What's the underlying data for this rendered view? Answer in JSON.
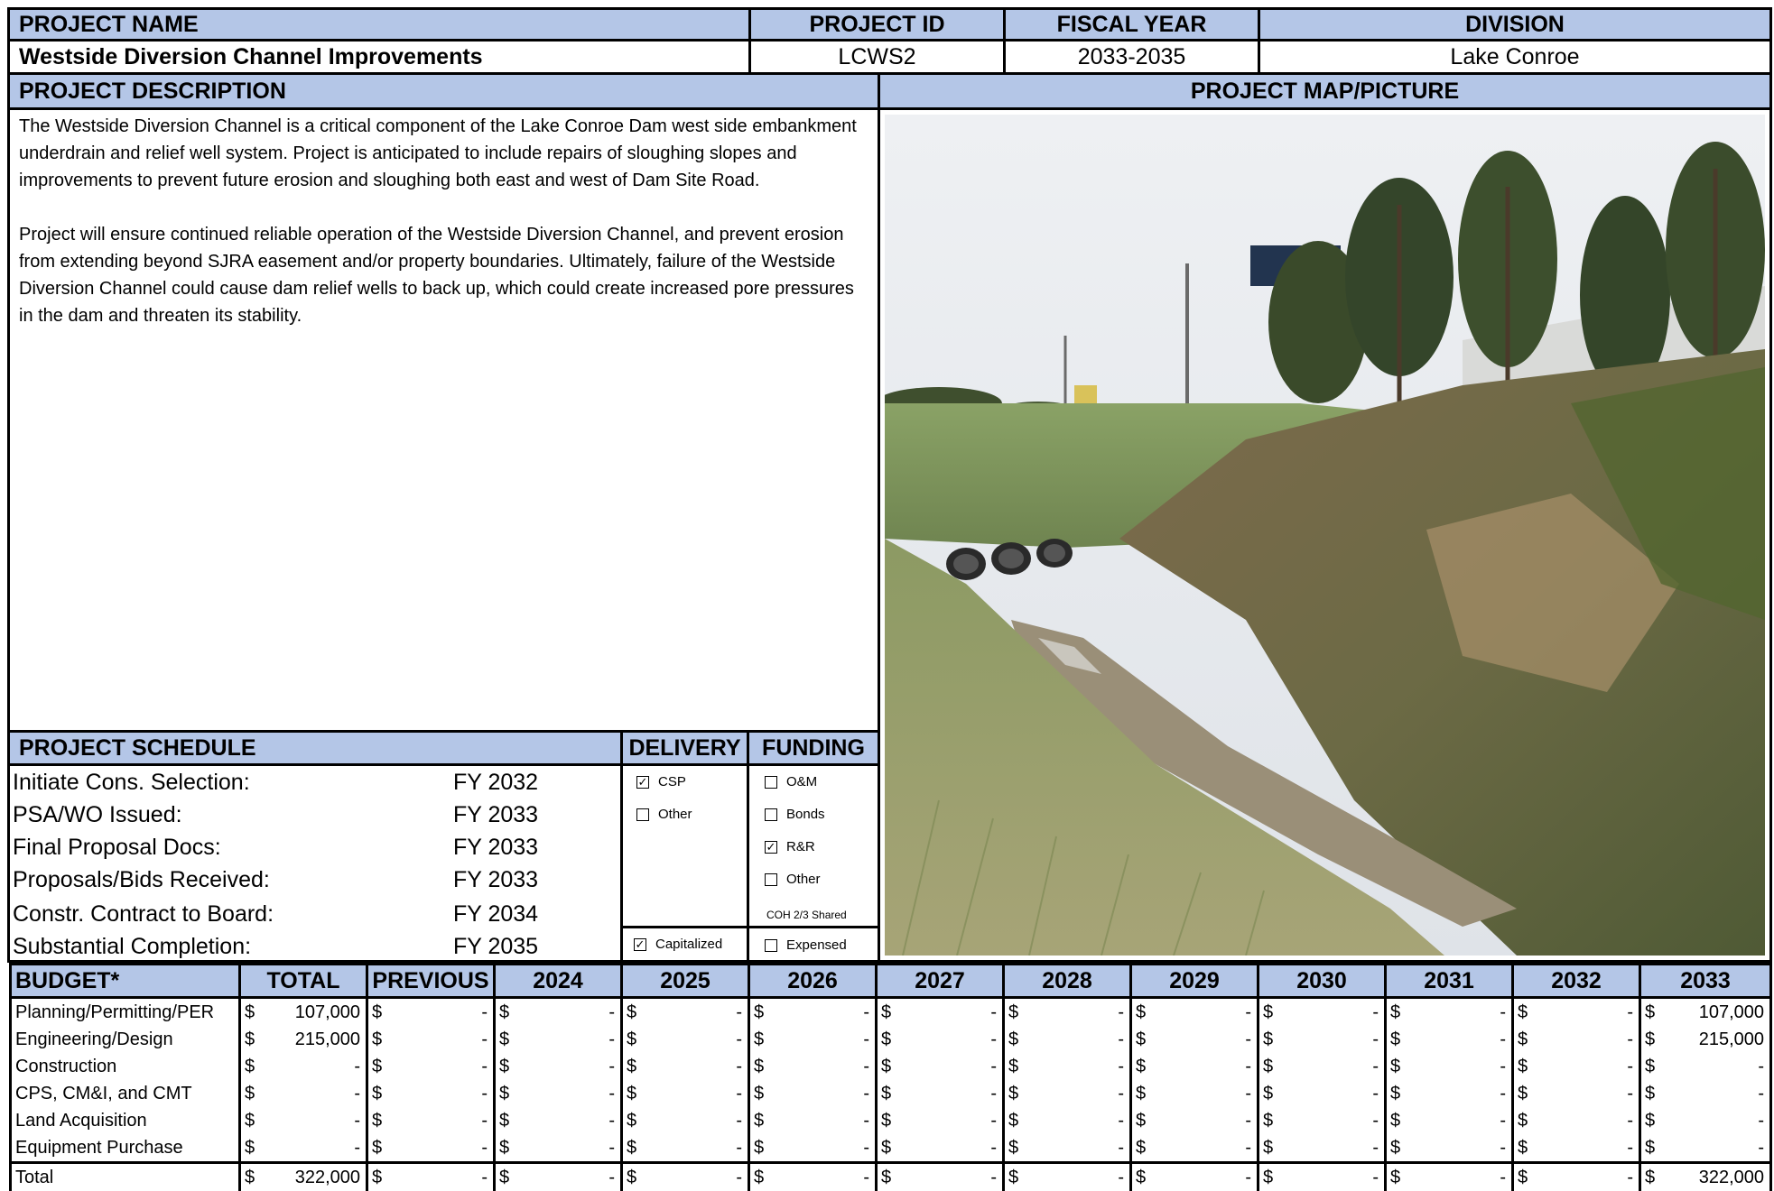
{
  "header": {
    "project_name_label": "PROJECT NAME",
    "project_id_label": "PROJECT ID",
    "fiscal_year_label": "FISCAL YEAR",
    "division_label": "DIVISION",
    "project_name": "Westside Diversion Channel Improvements",
    "project_id": "LCWS2",
    "fiscal_year": "2033-2035",
    "division": "Lake Conroe"
  },
  "description": {
    "label": "PROJECT DESCRIPTION",
    "paragraph1": "The Westside Diversion Channel is a critical component of the Lake Conroe Dam west side embankment underdrain and relief well system. Project is anticipated to include repairs of sloughing slopes and improvements to prevent future erosion and sloughing both east and west of Dam Site Road.",
    "paragraph2": "Project will ensure continued reliable operation of the Westside Diversion Channel, and prevent erosion from extending beyond SJRA easement and/or property boundaries.  Ultimately, failure of the Westside Diversion Channel could cause dam relief wells to back up, which could create increased pore pressures in the dam and threaten its stability."
  },
  "map": {
    "label": "PROJECT MAP/PICTURE"
  },
  "schedule": {
    "label": "PROJECT SCHEDULE",
    "delivery_label": "DELIVERY",
    "funding_label": "FUNDING",
    "rows": [
      {
        "item": "Initiate Cons. Selection:",
        "fy": "FY 2032"
      },
      {
        "item": "PSA/WO Issued:",
        "fy": "FY 2033"
      },
      {
        "item": "Final Proposal Docs:",
        "fy": "FY 2033"
      },
      {
        "item": "Proposals/Bids Received:",
        "fy": "FY 2033"
      },
      {
        "item": "Constr. Contract to Board:",
        "fy": "FY 2034"
      },
      {
        "item": "Substantial Completion:",
        "fy": "FY 2035"
      }
    ],
    "delivery": [
      {
        "label": "CSP",
        "checked": true
      },
      {
        "label": "Other",
        "checked": false
      }
    ],
    "funding": [
      {
        "label": "O&M",
        "checked": false
      },
      {
        "label": "Bonds",
        "checked": false
      },
      {
        "label": "R&R",
        "checked": true
      },
      {
        "label": "Other",
        "checked": false
      }
    ],
    "funding_note": "COH 2/3 Shared",
    "capitalized": {
      "label": "Capitalized",
      "checked": true
    },
    "expensed": {
      "label": "Expensed",
      "checked": false
    }
  },
  "budget": {
    "columns": [
      "BUDGET*",
      "TOTAL",
      "PREVIOUS",
      "2024",
      "2025",
      "2026",
      "2027",
      "2028",
      "2029",
      "2030",
      "2031",
      "2032",
      "2033"
    ],
    "currency": "$",
    "rows": [
      {
        "label": "Planning/Permitting/PER",
        "values": [
          "107,000",
          "-",
          "-",
          "-",
          "-",
          "-",
          "-",
          "-",
          "-",
          "-",
          "-",
          "107,000"
        ]
      },
      {
        "label": "Engineering/Design",
        "values": [
          "215,000",
          "-",
          "-",
          "-",
          "-",
          "-",
          "-",
          "-",
          "-",
          "-",
          "-",
          "215,000"
        ]
      },
      {
        "label": "Construction",
        "values": [
          "-",
          "-",
          "-",
          "-",
          "-",
          "-",
          "-",
          "-",
          "-",
          "-",
          "-",
          "-"
        ]
      },
      {
        "label": "CPS, CM&I, and CMT",
        "values": [
          "-",
          "-",
          "-",
          "-",
          "-",
          "-",
          "-",
          "-",
          "-",
          "-",
          "-",
          "-"
        ]
      },
      {
        "label": "Land Acquisition",
        "values": [
          "-",
          "-",
          "-",
          "-",
          "-",
          "-",
          "-",
          "-",
          "-",
          "-",
          "-",
          "-"
        ]
      },
      {
        "label": "Equipment Purchase",
        "values": [
          "-",
          "-",
          "-",
          "-",
          "-",
          "-",
          "-",
          "-",
          "-",
          "-",
          "-",
          "-"
        ]
      }
    ],
    "total": {
      "label": "Total",
      "values": [
        "322,000",
        "-",
        "-",
        "-",
        "-",
        "-",
        "-",
        "-",
        "-",
        "-",
        "-",
        "322,000"
      ]
    }
  }
}
